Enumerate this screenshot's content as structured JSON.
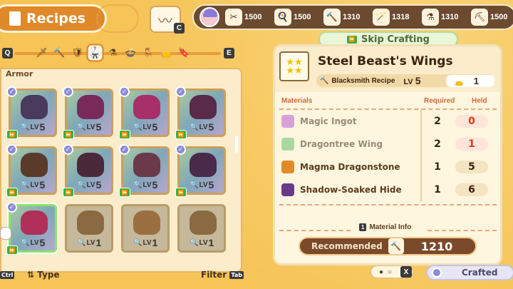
{
  "header": {
    "title": "Recipes",
    "codex_key": "C"
  },
  "resources": [
    {
      "icon": "shears-icon",
      "glyph": "✂",
      "value": "1500"
    },
    {
      "icon": "pan-icon",
      "glyph": "🍳",
      "value": "1500"
    },
    {
      "icon": "hammer-icon",
      "glyph": "🔨",
      "value": "1310"
    },
    {
      "icon": "staff-icon",
      "glyph": "🪄",
      "value": "1318"
    },
    {
      "icon": "potion-icon",
      "glyph": "⚗",
      "value": "1310"
    },
    {
      "icon": "pickaxe-icon",
      "glyph": "⛏",
      "value": "1500"
    }
  ],
  "categories": {
    "prev_key": "Q",
    "next_key": "E",
    "items": [
      {
        "icon": "sword-icon",
        "glyph": "🗡"
      },
      {
        "icon": "mace-icon",
        "glyph": "🔨"
      },
      {
        "icon": "shield-icon",
        "glyph": "🛡"
      },
      {
        "icon": "armor-icon",
        "glyph": "🥋",
        "selected": true
      },
      {
        "icon": "flask-icon",
        "glyph": "⚗"
      },
      {
        "icon": "pot-icon",
        "glyph": "🍲"
      },
      {
        "icon": "table-icon",
        "glyph": "🪑"
      },
      {
        "icon": "bag-icon",
        "glyph": "👝"
      },
      {
        "icon": "bookmark-icon",
        "glyph": "🔖"
      }
    ]
  },
  "section_label": "Armor",
  "recipes": [
    {
      "lv": "5",
      "color": "#4a3a5e"
    },
    {
      "lv": "5",
      "color": "#7a2a5a"
    },
    {
      "lv": "5",
      "color": "#a8306a"
    },
    {
      "lv": "5",
      "color": "#5a2a4a"
    },
    {
      "lv": "5",
      "color": "#5a3a2a"
    },
    {
      "lv": "5",
      "color": "#4a2a3a"
    },
    {
      "lv": "5",
      "color": "#6a3a4a"
    },
    {
      "lv": "5",
      "color": "#4a2a4a"
    },
    {
      "lv": "5",
      "color": "#b0305a"
    },
    {
      "lv": "1",
      "color": "#8a6a40"
    },
    {
      "lv": "1",
      "color": "#9a7040"
    },
    {
      "lv": "1",
      "color": "#8a6a40"
    }
  ],
  "lv_prefix": "LV",
  "footer": {
    "sort_key": "Ctrl",
    "type_label": "Type",
    "filter_label": "Filter",
    "filter_key": "Tab"
  },
  "skip_crafting": "Skip Crafting",
  "detail": {
    "name": "Steel Beast's Wings",
    "recipe_label": "Blacksmith Recipe",
    "lv": "LV",
    "lv_value": "5",
    "count": "1",
    "headers": {
      "materials": "Materials",
      "required": "Required",
      "held": "Held"
    },
    "materials": [
      {
        "name": "Magic Ingot",
        "required": "2",
        "held": "0",
        "lacking": true,
        "color": "#d8a0d8"
      },
      {
        "name": "Dragontree Wing",
        "required": "2",
        "held": "1",
        "lacking": true,
        "color": "#a8d8a0"
      },
      {
        "name": "Magma Dragonstone",
        "required": "1",
        "held": "5",
        "lacking": false,
        "color": "#e08a2a"
      },
      {
        "name": "Shadow-Soaked Hide",
        "required": "1",
        "held": "6",
        "lacking": false,
        "color": "#6a3a8a"
      }
    ],
    "material_info_key": "1",
    "material_info": "Material Info",
    "recommended_label": "Recommended",
    "recommended_value": "1210"
  },
  "close_key": "X",
  "crafted_label": "Crafted"
}
